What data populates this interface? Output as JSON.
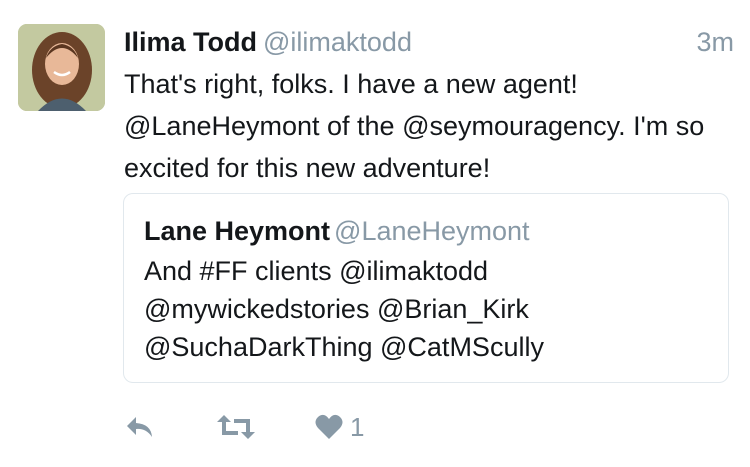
{
  "tweet": {
    "author_name": "Ilima Todd",
    "author_handle": "@ilimaktodd",
    "timestamp": "3m",
    "text": "That's right, folks. I have a new agent! @LaneHeymont of the @seymouragency. I'm so excited for this new adventure!",
    "avatar_icon": "profile-photo"
  },
  "quoted_tweet": {
    "author_name": "Lane Heymont",
    "author_handle": "@LaneHeymont",
    "text": "And #FF clients @ilimaktodd @mywickedstories @Brian_Kirk @SuchaDarkThing @CatMScully"
  },
  "actions": {
    "reply_icon": "reply-icon",
    "retweet_icon": "retweet-icon",
    "like_icon": "heart-icon",
    "like_count": "1"
  },
  "colors": {
    "text": "#14171a",
    "muted": "#8899a6",
    "border": "#e1e8ed"
  }
}
